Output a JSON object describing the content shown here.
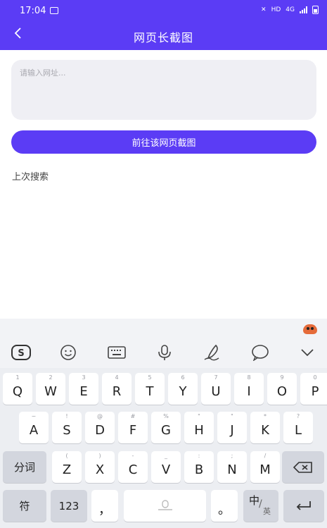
{
  "status_bar": {
    "time": "17:04",
    "hd": "HD",
    "network": "4G"
  },
  "header": {
    "title": "网页长截图"
  },
  "url_input": {
    "placeholder": "请输入网址...",
    "value": ""
  },
  "go_button": {
    "label": "前往该网页截图"
  },
  "recent": {
    "label": "上次搜索"
  },
  "keyboard": {
    "row1": [
      [
        "1",
        "Q"
      ],
      [
        "2",
        "W"
      ],
      [
        "3",
        "E"
      ],
      [
        "4",
        "R"
      ],
      [
        "5",
        "T"
      ],
      [
        "6",
        "Y"
      ],
      [
        "7",
        "U"
      ],
      [
        "8",
        "I"
      ],
      [
        "9",
        "O"
      ],
      [
        "0",
        "P"
      ]
    ],
    "row2": [
      [
        "~",
        "A"
      ],
      [
        "!",
        "S"
      ],
      [
        "@",
        "D"
      ],
      [
        "#",
        "F"
      ],
      [
        "%",
        "G"
      ],
      [
        "\"",
        "H"
      ],
      [
        "\"",
        "J"
      ],
      [
        "*",
        "K"
      ],
      [
        "?",
        "L"
      ]
    ],
    "row3": [
      [
        "(",
        "Z"
      ],
      [
        ")",
        "X"
      ],
      [
        "-",
        "C"
      ],
      [
        "_",
        "V"
      ],
      [
        ":",
        "B"
      ],
      [
        ";",
        "N"
      ],
      [
        "/",
        "M"
      ]
    ],
    "fenci": "分词",
    "fu": "符",
    "num": "123",
    "comma": "，",
    "period": "。",
    "zh": "中",
    "en": "英"
  },
  "colors": {
    "accent": "#5b3cf5",
    "input_bg": "#efeff4",
    "keyboard_bg": "#eceef2"
  }
}
